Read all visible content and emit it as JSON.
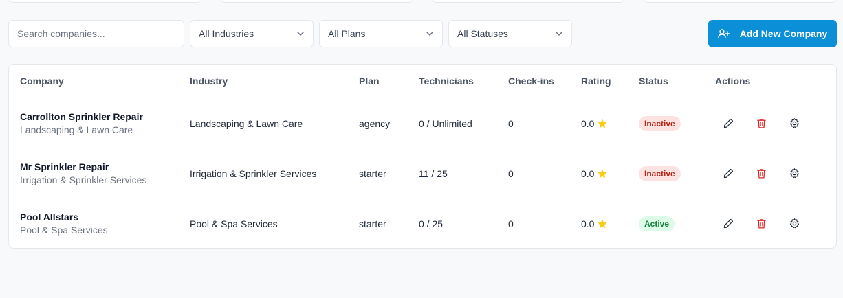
{
  "filters": {
    "search_placeholder": "Search companies...",
    "industry": "All Industries",
    "plan": "All Plans",
    "status": "All Statuses",
    "add_button": "Add New Company"
  },
  "colors": {
    "accent": "#0b8fd6",
    "inactive_bg": "#fde2e2",
    "inactive_text": "#b42318",
    "active_bg": "#dcfce7",
    "active_text": "#15803d",
    "star": "#facc15",
    "delete": "#dc2626"
  },
  "table": {
    "headers": [
      "Company",
      "Industry",
      "Plan",
      "Technicians",
      "Check-ins",
      "Rating",
      "Status",
      "Actions"
    ],
    "rows": [
      {
        "name": "Carrollton Sprinkler Repair",
        "sub": "Landscaping & Lawn Care",
        "industry": "Landscaping & Lawn Care",
        "plan": "agency",
        "technicians": "0 / Unlimited",
        "checkins": "0",
        "rating": "0.0",
        "status": "Inactive"
      },
      {
        "name": "Mr Sprinkler Repair",
        "sub": "Irrigation & Sprinkler Services",
        "industry": "Irrigation & Sprinkler Services",
        "plan": "starter",
        "technicians": "11 / 25",
        "checkins": "0",
        "rating": "0.0",
        "status": "Inactive"
      },
      {
        "name": "Pool Allstars",
        "sub": "Pool & Spa Services",
        "industry": "Pool & Spa Services",
        "plan": "starter",
        "technicians": "0 / 25",
        "checkins": "0",
        "rating": "0.0",
        "status": "Active"
      }
    ]
  }
}
